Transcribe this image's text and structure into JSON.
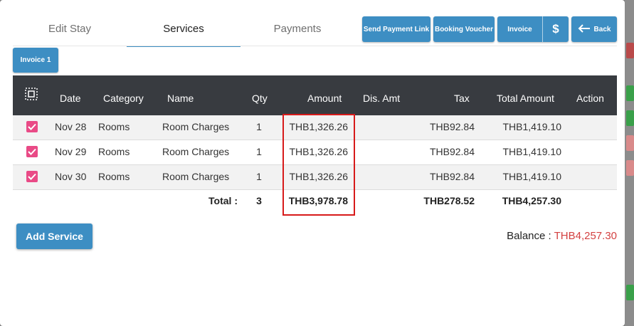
{
  "tabs": [
    {
      "label": "Edit Stay",
      "active": false
    },
    {
      "label": "Services",
      "active": true
    },
    {
      "label": "Payments",
      "active": false
    }
  ],
  "actions": {
    "send_payment_link": "Send Payment Link",
    "booking_voucher": "Booking Voucher",
    "invoice": "Invoice",
    "dollar_icon": "dollar-icon",
    "back": "Back",
    "back_icon": "arrow-left-icon"
  },
  "invoice_tab": "Invoice 1",
  "table": {
    "select_icon": "select-all-icon",
    "headers": {
      "date": "Date",
      "category": "Category",
      "name": "Name",
      "qty": "Qty",
      "amount": "Amount",
      "dis_amt": "Dis. Amt",
      "tax": "Tax",
      "total_amount": "Total Amount",
      "action": "Action"
    },
    "rows": [
      {
        "checked": true,
        "date": "Nov 28",
        "category": "Rooms",
        "name": "Room Charges",
        "qty": "1",
        "amount": "THB1,326.26",
        "dis_amt": "",
        "tax": "THB92.84",
        "total": "THB1,419.10"
      },
      {
        "checked": true,
        "date": "Nov 29",
        "category": "Rooms",
        "name": "Room Charges",
        "qty": "1",
        "amount": "THB1,326.26",
        "dis_amt": "",
        "tax": "THB92.84",
        "total": "THB1,419.10"
      },
      {
        "checked": true,
        "date": "Nov 30",
        "category": "Rooms",
        "name": "Room Charges",
        "qty": "1",
        "amount": "THB1,326.26",
        "dis_amt": "",
        "tax": "THB92.84",
        "total": "THB1,419.10"
      }
    ],
    "totals": {
      "label": "Total :",
      "qty": "3",
      "amount": "THB3,978.78",
      "tax": "THB278.52",
      "total": "THB4,257.30"
    }
  },
  "add_service": "Add Service",
  "balance": {
    "label": "Balance :",
    "amount": "THB4,257.30"
  },
  "colors": {
    "accent": "#3d8ec3",
    "header_bg": "#383b40",
    "checkbox": "#e94a86",
    "highlight": "#d71a1a",
    "balance_amount": "#d34141"
  }
}
